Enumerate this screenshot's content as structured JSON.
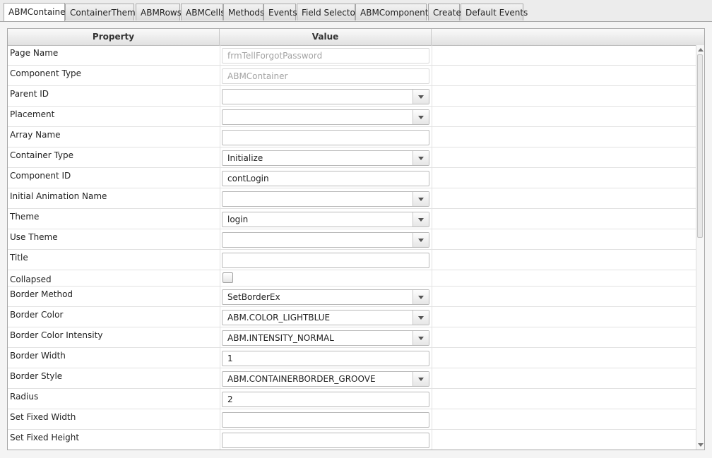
{
  "tabs": [
    {
      "label": "ABMContainer",
      "active": true
    },
    {
      "label": "ContainerTheme"
    },
    {
      "label": "ABMRows"
    },
    {
      "label": "ABMCells"
    },
    {
      "label": "Methods"
    },
    {
      "label": "Events"
    },
    {
      "label": "Field Selector"
    },
    {
      "label": "ABMComponents"
    },
    {
      "label": "Create"
    },
    {
      "label": "Default Events"
    }
  ],
  "grid": {
    "header": {
      "property": "Property",
      "value": "Value"
    },
    "rows": [
      {
        "name": "Page Name",
        "type": "text",
        "value": "frmTellForgotPassword",
        "disabled": true
      },
      {
        "name": "Component Type",
        "type": "text",
        "value": "ABMContainer",
        "disabled": true
      },
      {
        "name": "Parent ID",
        "type": "select",
        "value": ""
      },
      {
        "name": "Placement",
        "type": "select",
        "value": ""
      },
      {
        "name": "Array Name",
        "type": "text",
        "value": ""
      },
      {
        "name": "Container Type",
        "type": "select",
        "value": "Initialize"
      },
      {
        "name": "Component ID",
        "type": "text",
        "value": "contLogin"
      },
      {
        "name": "Initial Animation Name",
        "type": "select",
        "value": ""
      },
      {
        "name": "Theme",
        "type": "select",
        "value": "login"
      },
      {
        "name": "Use Theme",
        "type": "select",
        "value": ""
      },
      {
        "name": "Title",
        "type": "text",
        "value": ""
      },
      {
        "name": "Collapsed",
        "type": "checkbox",
        "checked": false
      },
      {
        "name": "Border Method",
        "type": "select",
        "value": "SetBorderEx"
      },
      {
        "name": "Border Color",
        "type": "select",
        "value": "ABM.COLOR_LIGHTBLUE"
      },
      {
        "name": "Border Color Intensity",
        "type": "select",
        "value": "ABM.INTENSITY_NORMAL"
      },
      {
        "name": "Border Width",
        "type": "text",
        "value": "1"
      },
      {
        "name": "Border Style",
        "type": "select",
        "value": "ABM.CONTAINERBORDER_GROOVE"
      },
      {
        "name": "Radius",
        "type": "text",
        "value": "2"
      },
      {
        "name": "Set Fixed Width",
        "type": "text",
        "value": ""
      },
      {
        "name": "Set Fixed Height",
        "type": "text",
        "value": ""
      }
    ]
  }
}
